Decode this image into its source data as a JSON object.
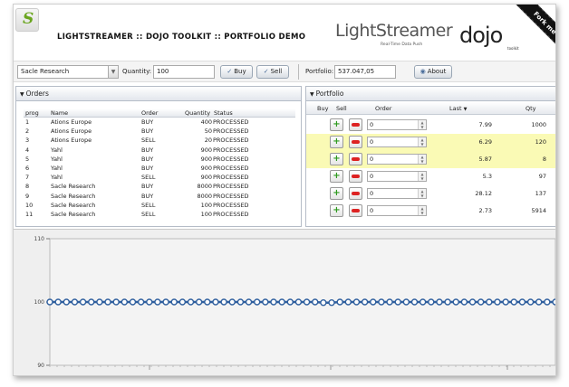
{
  "header": {
    "title": "LIGHTSTREAMER :: DOJO TOOLKIT :: PORTFOLIO DEMO",
    "lightstreamer_logo": "LightStreamer",
    "lightstreamer_tagline": "Real-Time Data Push",
    "dojo_logo": "dojo",
    "dojo_sub": "toolkit",
    "ribbon": "Fork me on"
  },
  "toolbar": {
    "stock_selected": "Sacle Research",
    "quantity_label": "Quantity:",
    "quantity_value": "100",
    "buy_label": "Buy",
    "sell_label": "Sell",
    "portfolio_label": "Portfolio:",
    "portfolio_value": "537.047,05",
    "about_label": "About"
  },
  "orders": {
    "title": "Orders",
    "columns": [
      "prog",
      "Name",
      "Order",
      "Quantity",
      "Status"
    ],
    "rows": [
      {
        "prog": "1",
        "name": "Ations Europe",
        "order": "BUY",
        "qty": "400",
        "status": "PROCESSED"
      },
      {
        "prog": "2",
        "name": "Ations Europe",
        "order": "BUY",
        "qty": "50",
        "status": "PROCESSED"
      },
      {
        "prog": "3",
        "name": "Ations Europe",
        "order": "SELL",
        "qty": "20",
        "status": "PROCESSED"
      },
      {
        "prog": "4",
        "name": "Yahl",
        "order": "BUY",
        "qty": "900",
        "status": "PROCESSED"
      },
      {
        "prog": "5",
        "name": "Yahl",
        "order": "BUY",
        "qty": "900",
        "status": "PROCESSED"
      },
      {
        "prog": "6",
        "name": "Yahl",
        "order": "BUY",
        "qty": "900",
        "status": "PROCESSED"
      },
      {
        "prog": "7",
        "name": "Yahl",
        "order": "SELL",
        "qty": "900",
        "status": "PROCESSED"
      },
      {
        "prog": "8",
        "name": "Sacle Research",
        "order": "BUY",
        "qty": "8000",
        "status": "PROCESSED"
      },
      {
        "prog": "9",
        "name": "Sacle Research",
        "order": "BUY",
        "qty": "8000",
        "status": "PROCESSED"
      },
      {
        "prog": "10",
        "name": "Sacle Research",
        "order": "SELL",
        "qty": "100",
        "status": "PROCESSED"
      },
      {
        "prog": "11",
        "name": "Sacle Research",
        "order": "SELL",
        "qty": "100",
        "status": "PROCESSED"
      }
    ]
  },
  "portfolio": {
    "title": "Portfolio",
    "columns": {
      "buy": "Buy",
      "sell": "Sell",
      "order": "Order",
      "last": "Last",
      "qty": "Qty"
    },
    "sort_indicator": "▼",
    "rows": [
      {
        "order": "0",
        "last": "7.99",
        "qty": "1000",
        "highlight": false
      },
      {
        "order": "0",
        "last": "6.29",
        "qty": "120",
        "highlight": true
      },
      {
        "order": "0",
        "last": "5.87",
        "qty": "8",
        "highlight": true
      },
      {
        "order": "0",
        "last": "5.3",
        "qty": "97",
        "highlight": false
      },
      {
        "order": "0",
        "last": "28.12",
        "qty": "137",
        "highlight": false
      },
      {
        "order": "0",
        "last": "2.73",
        "qty": "5914",
        "highlight": false
      }
    ]
  },
  "chart": {
    "y_ticks": [
      "110",
      "100",
      "90"
    ],
    "x_ticks": [
      "",
      "",
      ""
    ],
    "colors": {
      "line": "#2f5f9e",
      "marker": "#2f5f9e"
    }
  },
  "chart_data": {
    "type": "line",
    "title": "",
    "xlabel": "",
    "ylabel": "",
    "ylim": [
      90,
      110
    ],
    "series": [
      {
        "values": [
          100,
          100,
          100,
          100,
          100,
          100,
          100,
          100,
          100,
          100,
          100,
          100,
          100,
          100,
          100,
          100,
          100,
          100,
          100,
          100,
          100,
          100,
          100,
          100,
          100,
          100,
          100,
          100,
          100,
          100,
          100,
          100,
          100,
          99.9,
          99.9,
          100,
          100,
          100,
          100,
          100,
          100,
          100,
          100,
          100,
          100,
          100,
          100,
          100,
          100,
          100,
          100,
          100,
          100,
          100,
          100,
          100,
          100,
          100,
          100,
          100,
          100,
          100
        ]
      }
    ]
  }
}
